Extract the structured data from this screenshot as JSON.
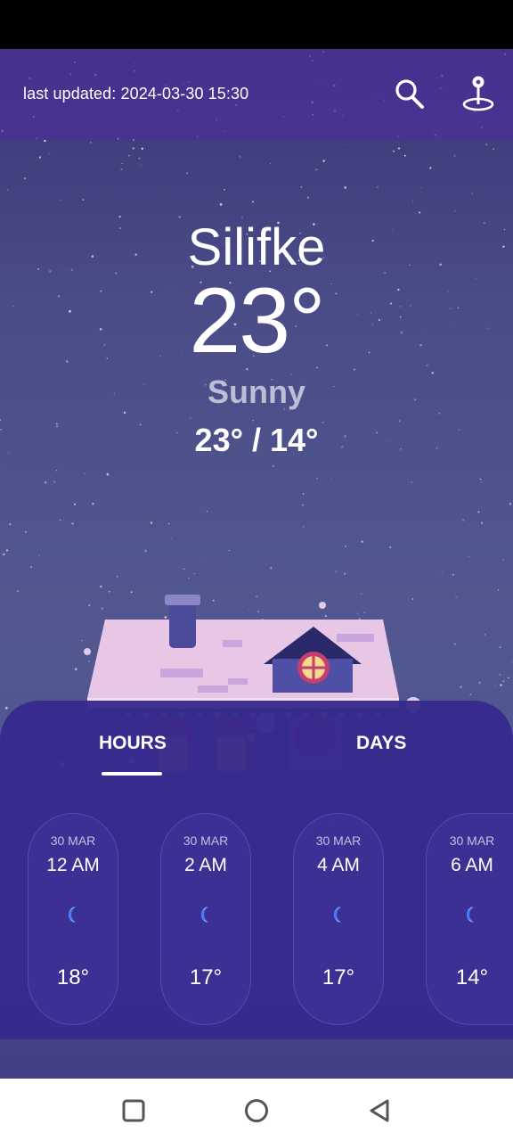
{
  "header": {
    "last_updated": "last updated: 2024-03-30 15:30"
  },
  "current": {
    "city": "Silifke",
    "temperature": "23°",
    "condition": "Sunny",
    "high_low": "23° / 14°"
  },
  "tabs": [
    {
      "label": "HOURS",
      "active": true
    },
    {
      "label": "DAYS",
      "active": false
    }
  ],
  "hourly": [
    {
      "date": "30 MAR",
      "time": "12 AM",
      "icon": "moon-icon",
      "temp": "18°"
    },
    {
      "date": "30 MAR",
      "time": "2 AM",
      "icon": "moon-icon",
      "temp": "17°"
    },
    {
      "date": "30 MAR",
      "time": "4 AM",
      "icon": "moon-icon",
      "temp": "17°"
    },
    {
      "date": "30 MAR",
      "time": "6 AM",
      "icon": "moon-icon",
      "temp": "14°"
    }
  ],
  "icons": {
    "search": "search-icon",
    "location": "location-pin-icon",
    "nav_recent": "square-icon",
    "nav_home": "circle-icon",
    "nav_back": "triangle-back-icon"
  },
  "colors": {
    "panel": "#362a8c",
    "top_bar": "#4e2e9c",
    "accent_moon": "#3f7bff"
  }
}
